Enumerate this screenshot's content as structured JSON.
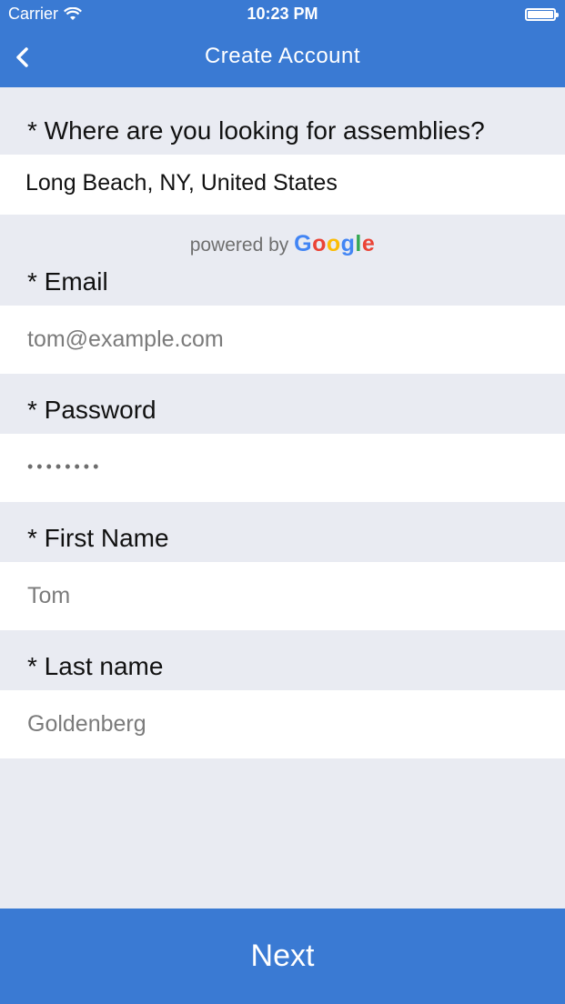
{
  "status_bar": {
    "carrier": "Carrier",
    "time": "10:23 PM"
  },
  "nav": {
    "title": "Create Account",
    "back_icon": "chevron-left-icon"
  },
  "form": {
    "location": {
      "label": "* Where are you looking for assemblies?",
      "value": "Long Beach, NY, United States"
    },
    "powered_by": {
      "prefix": "powered by",
      "brand": "Google"
    },
    "email": {
      "label": "* Email",
      "placeholder": "tom@example.com"
    },
    "password": {
      "label": "* Password",
      "value": "••••••••"
    },
    "first_name": {
      "label": "* First Name",
      "placeholder": "Tom"
    },
    "last_name": {
      "label": "* Last name",
      "placeholder": "Goldenberg"
    }
  },
  "footer": {
    "next_label": "Next"
  },
  "colors": {
    "accent": "#3a7ad3",
    "background": "#e9ebf2"
  }
}
